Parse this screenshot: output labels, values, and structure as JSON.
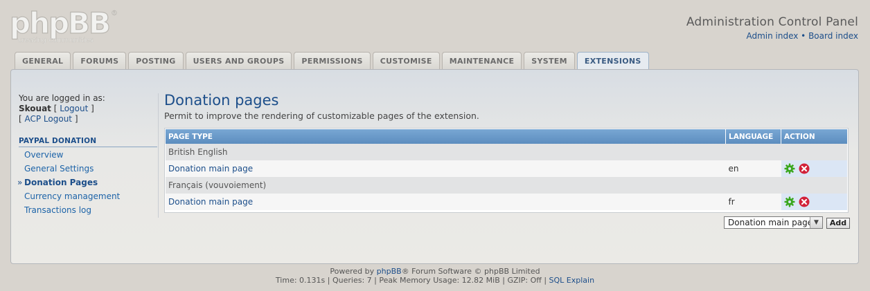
{
  "logo": {
    "text": "phpBB",
    "tagline": "creating communities",
    "mark": "®"
  },
  "header": {
    "title": "Administration Control Panel",
    "admin_index": "Admin index",
    "separator": "•",
    "board_index": "Board index"
  },
  "tabs": [
    {
      "label": "GENERAL",
      "active": false
    },
    {
      "label": "FORUMS",
      "active": false
    },
    {
      "label": "POSTING",
      "active": false
    },
    {
      "label": "USERS AND GROUPS",
      "active": false
    },
    {
      "label": "PERMISSIONS",
      "active": false
    },
    {
      "label": "CUSTOMISE",
      "active": false
    },
    {
      "label": "MAINTENANCE",
      "active": false
    },
    {
      "label": "SYSTEM",
      "active": false
    },
    {
      "label": "EXTENSIONS",
      "active": true
    }
  ],
  "sidebar": {
    "logged_in_as": "You are logged in as:",
    "username": "Skouat",
    "logout": "Logout",
    "acp_logout": "ACP Logout",
    "section_title": "PAYPAL DONATION",
    "items": [
      {
        "label": "Overview"
      },
      {
        "label": "General Settings"
      },
      {
        "label": "Donation Pages"
      },
      {
        "label": "Currency management"
      },
      {
        "label": "Transactions log"
      }
    ]
  },
  "main": {
    "title": "Donation pages",
    "description": "Permit to improve the rendering of customizable pages of the extension.",
    "table": {
      "headers": {
        "page_type": "PAGE TYPE",
        "language": "LANGUAGE",
        "action": "ACTION"
      },
      "groups": [
        {
          "language_name": "British English",
          "rows": [
            {
              "page": "Donation main page",
              "lang": "en"
            }
          ]
        },
        {
          "language_name": "Français (vouvoiement)",
          "rows": [
            {
              "page": "Donation main page",
              "lang": "fr"
            }
          ]
        }
      ]
    },
    "select_value": "Donation main page",
    "add_label": "Add"
  },
  "footer": {
    "powered_prefix": "Powered by",
    "phpbb_link": "phpBB",
    "powered_suffix": "® Forum Software © phpBB Limited",
    "stats": "Time: 0.131s | Queries: 7 | Peak Memory Usage: 12.82 MiB | GZIP: Off |",
    "sql_explain": "SQL Explain"
  },
  "colors": {
    "accent": "#1c4e8a",
    "table_header": "#6a9acb",
    "settings_icon": "#3aa71e",
    "delete_icon": "#d2223a"
  },
  "icons": {
    "settings": "gear-icon",
    "delete": "delete-icon"
  }
}
